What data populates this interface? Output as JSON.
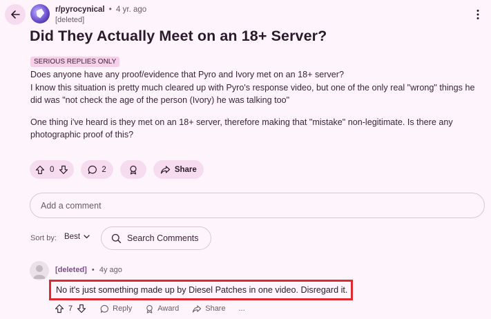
{
  "post": {
    "subreddit": "r/pyrocynical",
    "age": "4 yr. ago",
    "author": "[deleted]",
    "title": "Did They Actually Meet on an 18+ Server?",
    "flair": "SERIOUS REPLIES ONLY",
    "body": [
      "Does anyone have any proof/evidence that Pyro and Ivory met on an 18+ server?",
      "I know this situation is pretty much cleared up with Pyro's response video, but one of the only real \"wrong\" things he did was \"not check the age of the person (Ivory) he was talking too\"",
      "One thing i've heard is they met on an 18+ server, therefore making that \"mistake\" non-legitimate. Is there any photographic proof of this?"
    ],
    "votes": "0",
    "comments": "2",
    "share_label": "Share"
  },
  "comment_box": {
    "placeholder": "Add a comment"
  },
  "sort": {
    "label": "Sort by:",
    "value": "Best"
  },
  "search": {
    "label": "Search Comments"
  },
  "comment": {
    "author": "[deleted]",
    "age": "4y ago",
    "text": "No it's just something made up by Diesel Patches in one video. Disregard it.",
    "votes": "7",
    "reply_label": "Reply",
    "award_label": "Award",
    "share_label": "Share",
    "more_label": "..."
  },
  "icons": {
    "back": "back-arrow-icon",
    "more": "kebab-menu-icon",
    "upvote": "upvote-icon",
    "downvote": "downvote-icon",
    "comment": "comment-bubble-icon",
    "award": "award-icon",
    "share": "share-icon",
    "search": "search-icon",
    "chevron": "chevron-down-icon"
  },
  "colors": {
    "background": "#fdf5fb",
    "pill": "#f6dcee",
    "flair": "#f6cfe9",
    "highlight_border": "#e0282f"
  }
}
